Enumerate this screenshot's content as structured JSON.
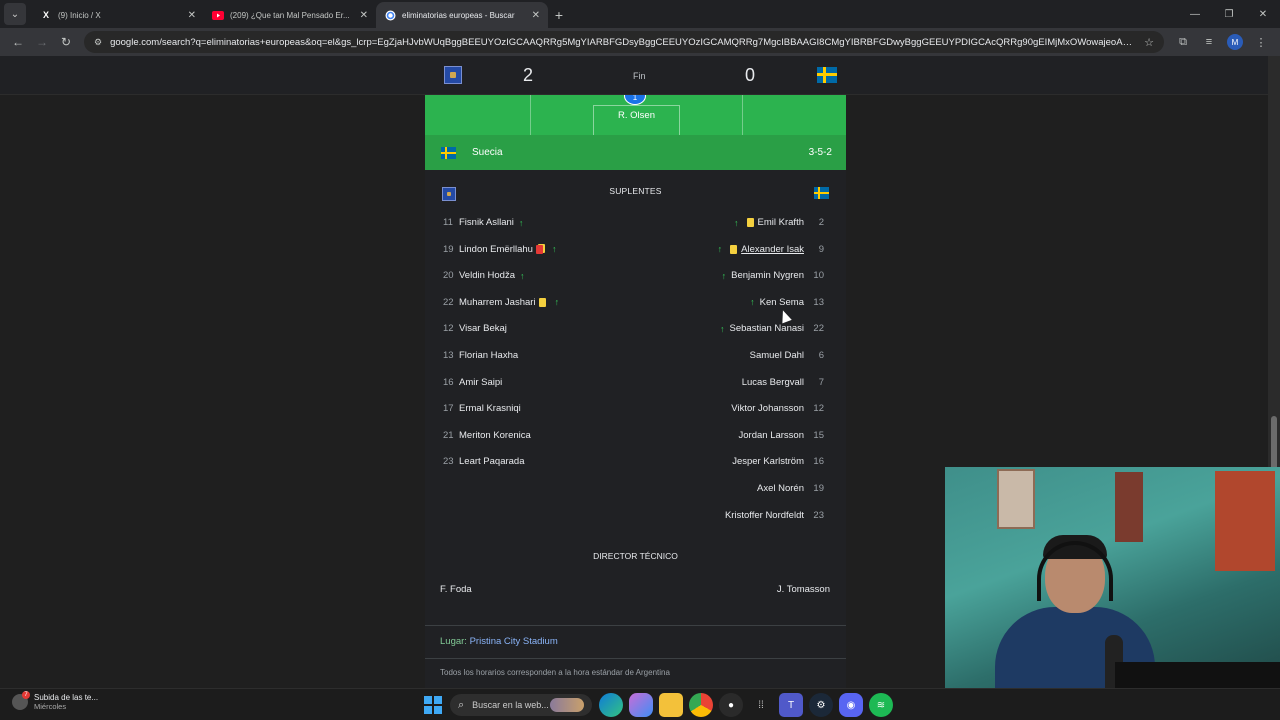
{
  "browser": {
    "tabs": [
      {
        "title": "(9) Inicio / X",
        "favicon": "x-logo-icon",
        "active": false
      },
      {
        "title": "(209) ¿Que tan Mal Pensado Er...",
        "favicon": "youtube-icon",
        "active": false
      },
      {
        "title": "eliminatorias europeas - Buscar",
        "favicon": "google-icon",
        "active": true
      }
    ],
    "url": "google.com/search?q=eliminatorias+europeas&oq=el&gs_lcrp=EgZjaHJvbWUqBggBEEUYOzIGCAAQRRg5MgYIARBFGDsyBggCEEUYOzIGCAMQRRg7MgcIBBAAGI8CMgYIBRBFGDwyBggGEEUYPDIGCAcQRRg90gEIMjMxOWowajeoAgCwAgA&sourceid...",
    "profile_initial": "M"
  },
  "score": {
    "home_score": "2",
    "away_score": "0",
    "status": "Fin"
  },
  "pitch": {
    "goalkeeper_number": "1",
    "goalkeeper_name": "R. Olsen"
  },
  "team_bar": {
    "name": "Suecia",
    "formation": "3-5-2"
  },
  "subs": {
    "header": "SUPLENTES",
    "home": [
      {
        "num": "11",
        "name": "Fisnik Asllani",
        "card": "",
        "sub": true
      },
      {
        "num": "19",
        "name": "Lindon Emërllahu",
        "card": "red",
        "sub": true
      },
      {
        "num": "20",
        "name": "Veldin Hodža",
        "card": "",
        "sub": true
      },
      {
        "num": "22",
        "name": "Muharrem Jashari",
        "card": "yellow",
        "sub": true
      },
      {
        "num": "12",
        "name": "Visar Bekaj",
        "card": "",
        "sub": false
      },
      {
        "num": "13",
        "name": "Florian Haxha",
        "card": "",
        "sub": false
      },
      {
        "num": "16",
        "name": "Amir Saipi",
        "card": "",
        "sub": false
      },
      {
        "num": "17",
        "name": "Ermal Krasniqi",
        "card": "",
        "sub": false
      },
      {
        "num": "21",
        "name": "Meriton Korenica",
        "card": "",
        "sub": false
      },
      {
        "num": "23",
        "name": "Leart Paqarada",
        "card": "",
        "sub": false
      }
    ],
    "away": [
      {
        "num": "2",
        "name": "Emil Krafth",
        "card": "yellow",
        "sub": true
      },
      {
        "num": "9",
        "name": "Alexander Isak",
        "card": "yellow",
        "sub": true,
        "hover": true
      },
      {
        "num": "10",
        "name": "Benjamin Nygren",
        "card": "",
        "sub": true
      },
      {
        "num": "13",
        "name": "Ken Sema",
        "card": "",
        "sub": true
      },
      {
        "num": "22",
        "name": "Sebastian Nanasi",
        "card": "",
        "sub": true
      },
      {
        "num": "6",
        "name": "Samuel Dahl",
        "card": "",
        "sub": false
      },
      {
        "num": "7",
        "name": "Lucas Bergvall",
        "card": "",
        "sub": false
      },
      {
        "num": "12",
        "name": "Viktor Johansson",
        "card": "",
        "sub": false
      },
      {
        "num": "15",
        "name": "Jordan Larsson",
        "card": "",
        "sub": false
      },
      {
        "num": "16",
        "name": "Jesper Karlström",
        "card": "",
        "sub": false
      },
      {
        "num": "19",
        "name": "Axel Norén",
        "card": "",
        "sub": false
      },
      {
        "num": "23",
        "name": "Kristoffer Nordfeldt",
        "card": "",
        "sub": false
      }
    ]
  },
  "coaches": {
    "header": "DIRECTOR TÉCNICO",
    "home": "F. Foda",
    "away": "J. Tomasson"
  },
  "venue": {
    "label": "Lugar:",
    "value": "Pristina City Stadium"
  },
  "footer_note": "Todos los horarios corresponden a la hora estándar de Argentina",
  "taskbar": {
    "notification_title": "Subida de las te...",
    "notification_sub": "Miércoles",
    "notification_badge": "7",
    "search_placeholder": "Buscar en la web..."
  },
  "icons": {
    "sub_in": "↑",
    "up_arrow_color": "#34c759"
  }
}
